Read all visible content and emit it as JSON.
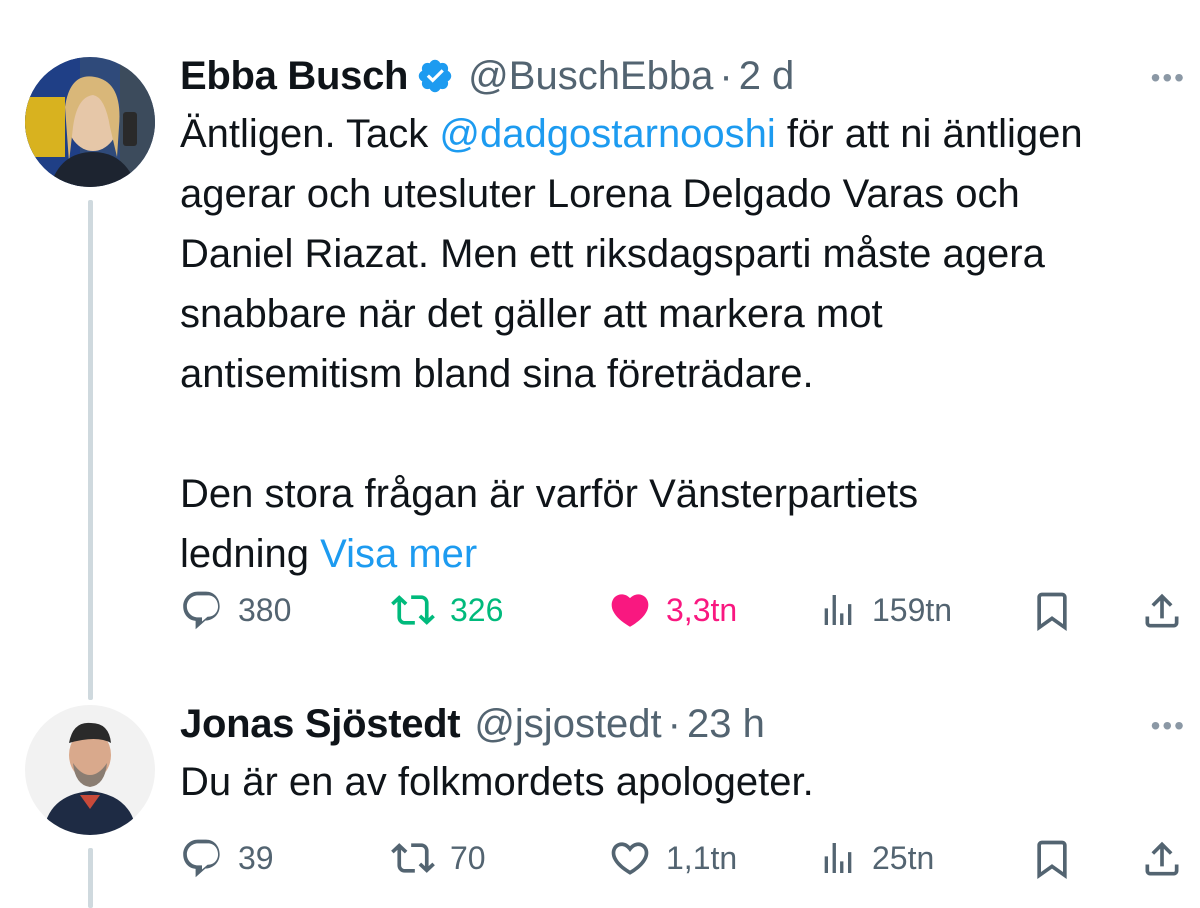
{
  "tweets": [
    {
      "name": "Ebba Busch",
      "handle": "@BuschEbba",
      "dot": "·",
      "time": "2 d",
      "more": "•••",
      "text": {
        "line1_pre": "Äntligen. Tack ",
        "mention": "@dadgostarnooshi",
        "line1_post": " för att ni äntligen",
        "line2": "agerar och utesluter Lorena Delgado Varas och",
        "line3": "Daniel Riazat. Men ett riksdagsparti måste agera",
        "line4": "snabbare när det gäller att markera mot",
        "line5": "antisemitism bland sina företrädare.",
        "line6": "Den stora frågan är varför Vänsterpartiets",
        "line7_pre": "ledning ",
        "show_more": "Visa mer"
      },
      "stats": {
        "replies": "380",
        "retweets": "326",
        "likes": "3,3tn",
        "views": "159tn"
      },
      "verified": true,
      "liked": true,
      "retweeted": true
    },
    {
      "name": "Jonas Sjöstedt",
      "handle": "@jsjostedt",
      "dot": "·",
      "time": "23 h",
      "more": "•••",
      "text": {
        "line1": "Du är en av folkmordets apologeter."
      },
      "stats": {
        "replies": "39",
        "retweets": "70",
        "likes": "1,1tn",
        "views": "25tn"
      },
      "verified": false,
      "liked": false,
      "retweeted": false
    }
  ],
  "colors": {
    "link": "#1d9bf0",
    "retweet": "#00ba7c",
    "like": "#f91880",
    "secondary": "#536471",
    "thread_line": "#cfd9de"
  },
  "icons": [
    "reply-icon",
    "retweet-icon",
    "like-icon",
    "views-icon",
    "bookmark-icon",
    "share-icon",
    "verified-badge-icon",
    "more-icon"
  ]
}
